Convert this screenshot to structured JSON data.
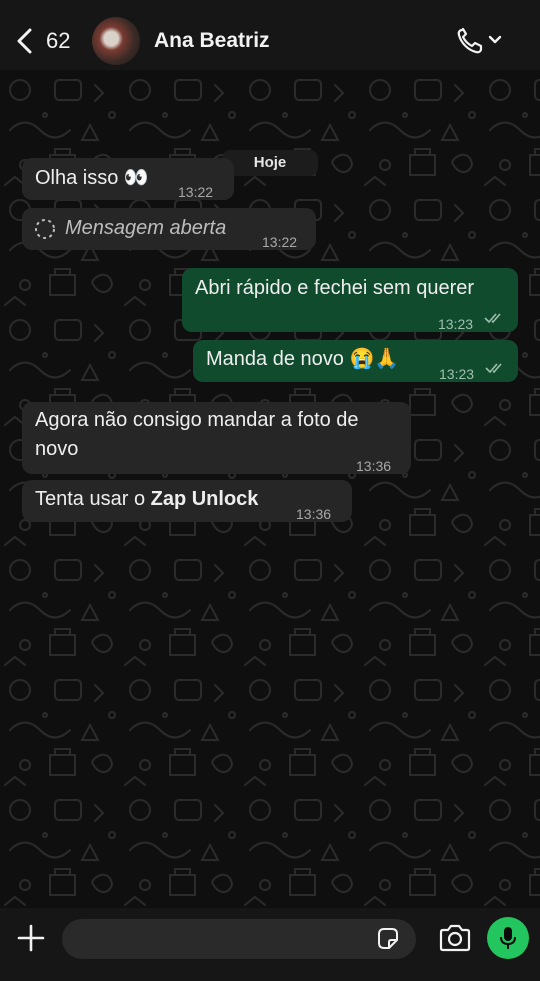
{
  "header": {
    "back_count": "62",
    "contact_name": "Ana Beatriz"
  },
  "chat": {
    "date_label": "Hoje",
    "messages": [
      {
        "direction": "incoming",
        "text": "Olha isso 👀",
        "time": "13:22"
      },
      {
        "direction": "incoming",
        "text": "Mensagem aberta",
        "time": "13:22",
        "kind": "view-once-opened"
      },
      {
        "direction": "outgoing",
        "text": "Abri rápido e fechei sem querer",
        "time": "13:23",
        "status": "read"
      },
      {
        "direction": "outgoing",
        "text": "Manda de novo 😭🙏",
        "time": "13:23",
        "status": "read"
      },
      {
        "direction": "incoming",
        "text_line1": "Agora não consigo mandar a foto de",
        "text_line2": "novo",
        "time": "13:36"
      },
      {
        "direction": "incoming",
        "text_prefix": "Tenta usar o ",
        "text_bold": "Zap Unlock",
        "time": "13:36"
      }
    ]
  },
  "input": {
    "placeholder": "",
    "value": ""
  },
  "colors": {
    "incoming_bubble": "#262626",
    "outgoing_bubble": "#104b2e",
    "read_ticks": "#9fbfaf",
    "mic_button": "#22c55e"
  },
  "icons": [
    "back-chevron-icon",
    "avatar",
    "phone-icon",
    "chevron-down-icon",
    "spinner-icon",
    "double-check-icon",
    "plus-icon",
    "sticker-icon",
    "camera-icon",
    "microphone-icon"
  ]
}
